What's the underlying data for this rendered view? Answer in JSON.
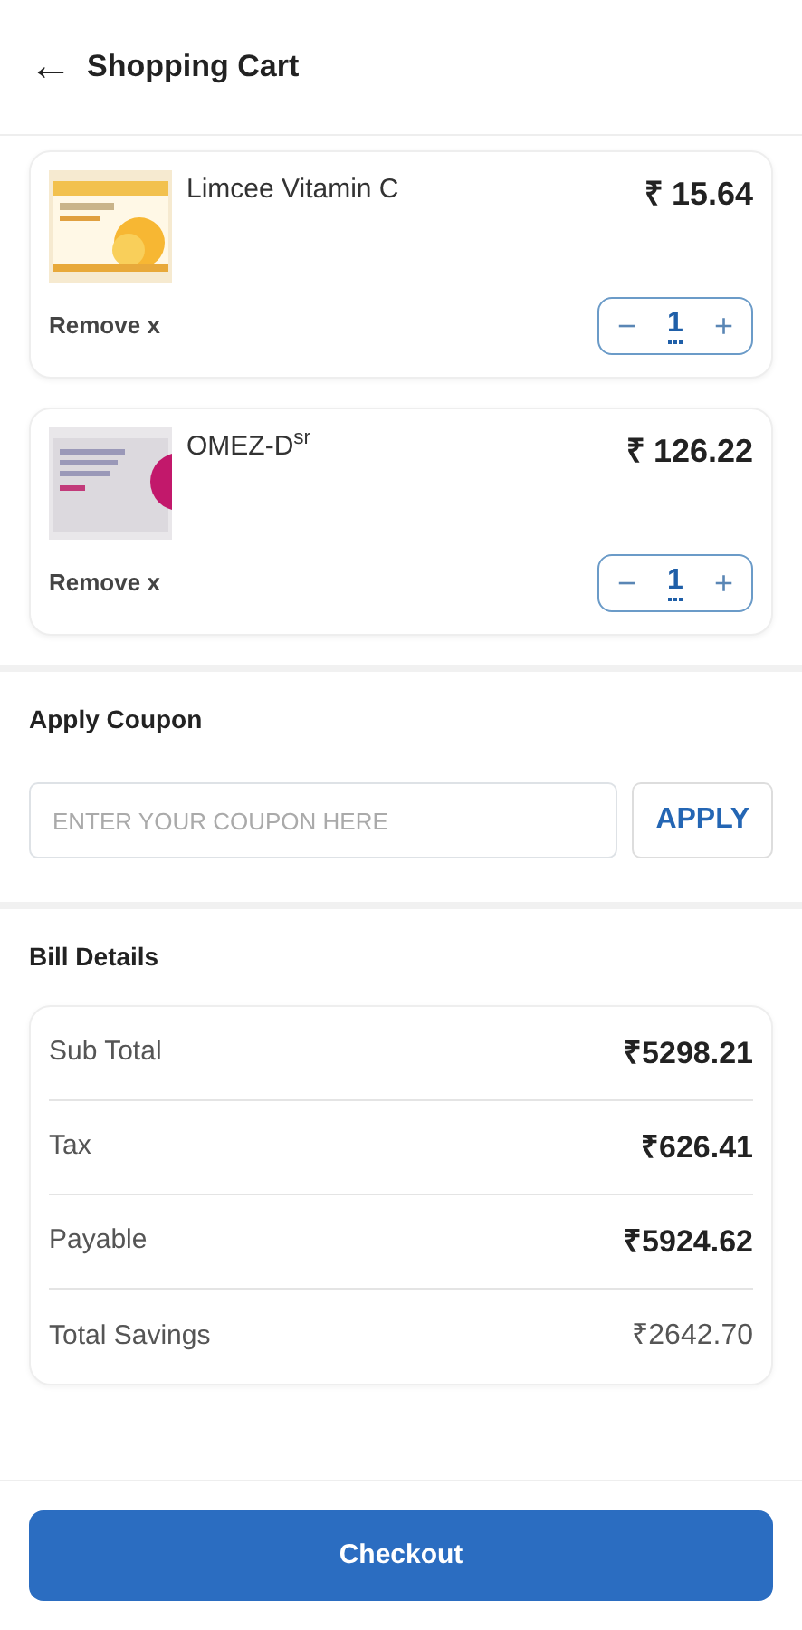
{
  "header": {
    "back": "←",
    "title": "Shopping Cart"
  },
  "items": [
    {
      "name": "Limcee Vitamin C",
      "price": "₹ 15.64",
      "remove": "Remove x",
      "minus": "−",
      "qty": "1",
      "plus": "+"
    },
    {
      "name": "OMEZ-D$^{sr}$",
      "price": "₹ 126.22",
      "remove": "Remove x",
      "minus": "−",
      "qty": "1",
      "plus": "+"
    }
  ],
  "coupon": {
    "heading": "Apply Coupon",
    "placeholder": "ENTER YOUR COUPON HERE",
    "button": "APPLY"
  },
  "bill": {
    "heading": "Bill Details",
    "rows": [
      {
        "label": "Sub Total",
        "value": "₹5298.21",
        "bold": true
      },
      {
        "label": "Tax",
        "value": "₹626.41",
        "bold": true
      },
      {
        "label": "Payable",
        "value": "₹5924.62",
        "bold": true
      },
      {
        "label": "Total Savings",
        "value": "₹2642.70",
        "bold": false
      }
    ]
  },
  "checkout": "Checkout"
}
